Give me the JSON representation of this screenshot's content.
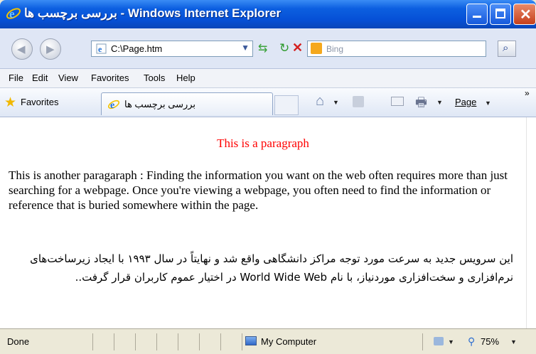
{
  "window": {
    "title": "بررسی برچسب ها - Windows Internet Explorer"
  },
  "address_bar": {
    "url": "C:\\Page.htm",
    "search_placeholder": "Bing"
  },
  "menu": {
    "items": [
      "File",
      "Edit",
      "View",
      "Favorites",
      "Tools",
      "Help"
    ]
  },
  "favorites_bar": {
    "favorites_label": "Favorites",
    "tab_title": "بررسی برچسب ها",
    "page_menu_label": "Page"
  },
  "page": {
    "paragraph1": "This is a paragraph",
    "paragraph2": "This is another paragaraph : Finding the information you want on the web often requires more than just searching for a webpage. Once you're viewing a webpage, you often need to find the information or reference that is buried somewhere within the page.",
    "paragraph3": "این سرویس جدید به سرعت مورد توجه مراکز دانشگاهی واقع شد و نهایتاً در سال ۱۹۹۳ با ایجاد زیرساخت‌های نرم‌افزاری و سخت‌افزاری موردنیاز، با نام World Wide Web در اختیار عموم کاربران قرار گرفت.."
  },
  "status_bar": {
    "status": "Done",
    "zone": "My Computer",
    "zoom": "75%"
  },
  "colors": {
    "title_bar": "#0650d6",
    "paragraph_red": "#ff0000",
    "chrome": "#ece9d8"
  }
}
